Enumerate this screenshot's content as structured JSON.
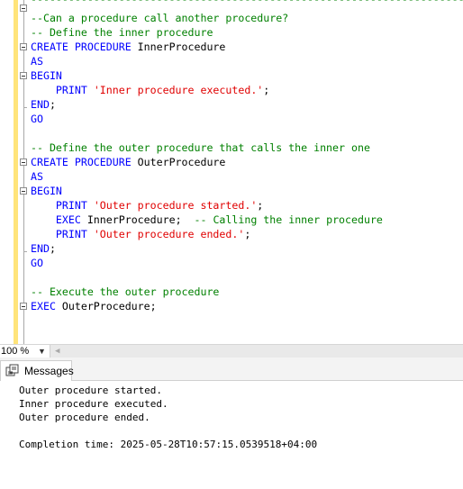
{
  "editor": {
    "header_dashes": "--------------------------------------------------------------------------------------",
    "lines": [
      [
        {
          "t": "--Can a procedure call another procedure?",
          "c": "cmt"
        }
      ],
      [
        {
          "t": "-- Define the inner procedure",
          "c": "cmt"
        }
      ],
      [
        {
          "t": "CREATE PROCEDURE ",
          "c": "kw"
        },
        {
          "t": "InnerProcedure",
          "c": "plain"
        }
      ],
      [
        {
          "t": "AS",
          "c": "kw"
        }
      ],
      [
        {
          "t": "BEGIN",
          "c": "kw"
        }
      ],
      [
        {
          "t": "    ",
          "c": "plain"
        },
        {
          "t": "PRINT ",
          "c": "kw"
        },
        {
          "t": "'Inner procedure executed.'",
          "c": "str"
        },
        {
          "t": ";",
          "c": "plain"
        }
      ],
      [
        {
          "t": "END",
          "c": "kw"
        },
        {
          "t": ";",
          "c": "plain"
        }
      ],
      [
        {
          "t": "GO",
          "c": "kw"
        }
      ],
      [],
      [
        {
          "t": "-- Define the outer procedure that calls the inner one",
          "c": "cmt"
        }
      ],
      [
        {
          "t": "CREATE PROCEDURE ",
          "c": "kw"
        },
        {
          "t": "OuterProcedure",
          "c": "plain"
        }
      ],
      [
        {
          "t": "AS",
          "c": "kw"
        }
      ],
      [
        {
          "t": "BEGIN",
          "c": "kw"
        }
      ],
      [
        {
          "t": "    ",
          "c": "plain"
        },
        {
          "t": "PRINT ",
          "c": "kw"
        },
        {
          "t": "'Outer procedure started.'",
          "c": "str"
        },
        {
          "t": ";",
          "c": "plain"
        }
      ],
      [
        {
          "t": "    ",
          "c": "plain"
        },
        {
          "t": "EXEC ",
          "c": "kw"
        },
        {
          "t": "InnerProcedure",
          "c": "plain"
        },
        {
          "t": ";  ",
          "c": "plain"
        },
        {
          "t": "-- Calling the inner procedure",
          "c": "cmt"
        }
      ],
      [
        {
          "t": "    ",
          "c": "plain"
        },
        {
          "t": "PRINT ",
          "c": "kw"
        },
        {
          "t": "'Outer procedure ended.'",
          "c": "str"
        },
        {
          "t": ";",
          "c": "plain"
        }
      ],
      [
        {
          "t": "END",
          "c": "kw"
        },
        {
          "t": ";",
          "c": "plain"
        }
      ],
      [
        {
          "t": "GO",
          "c": "kw"
        }
      ],
      [],
      [
        {
          "t": "-- Execute the outer procedure",
          "c": "cmt"
        }
      ],
      [
        {
          "t": "EXEC ",
          "c": "kw"
        },
        {
          "t": "OuterProcedure",
          "c": "plain"
        },
        {
          "t": ";",
          "c": "plain"
        }
      ]
    ]
  },
  "zoom": {
    "value": "100 %"
  },
  "results": {
    "tab_label": "Messages",
    "messages": [
      "Outer procedure started.",
      "Inner procedure executed.",
      "Outer procedure ended.",
      "",
      "Completion time: 2025-05-28T10:57:15.0539518+04:00"
    ]
  },
  "colors": {
    "keyword": "#0000ff",
    "comment": "#008000",
    "string": "#e00000",
    "change_bar": "#ffe47a"
  }
}
